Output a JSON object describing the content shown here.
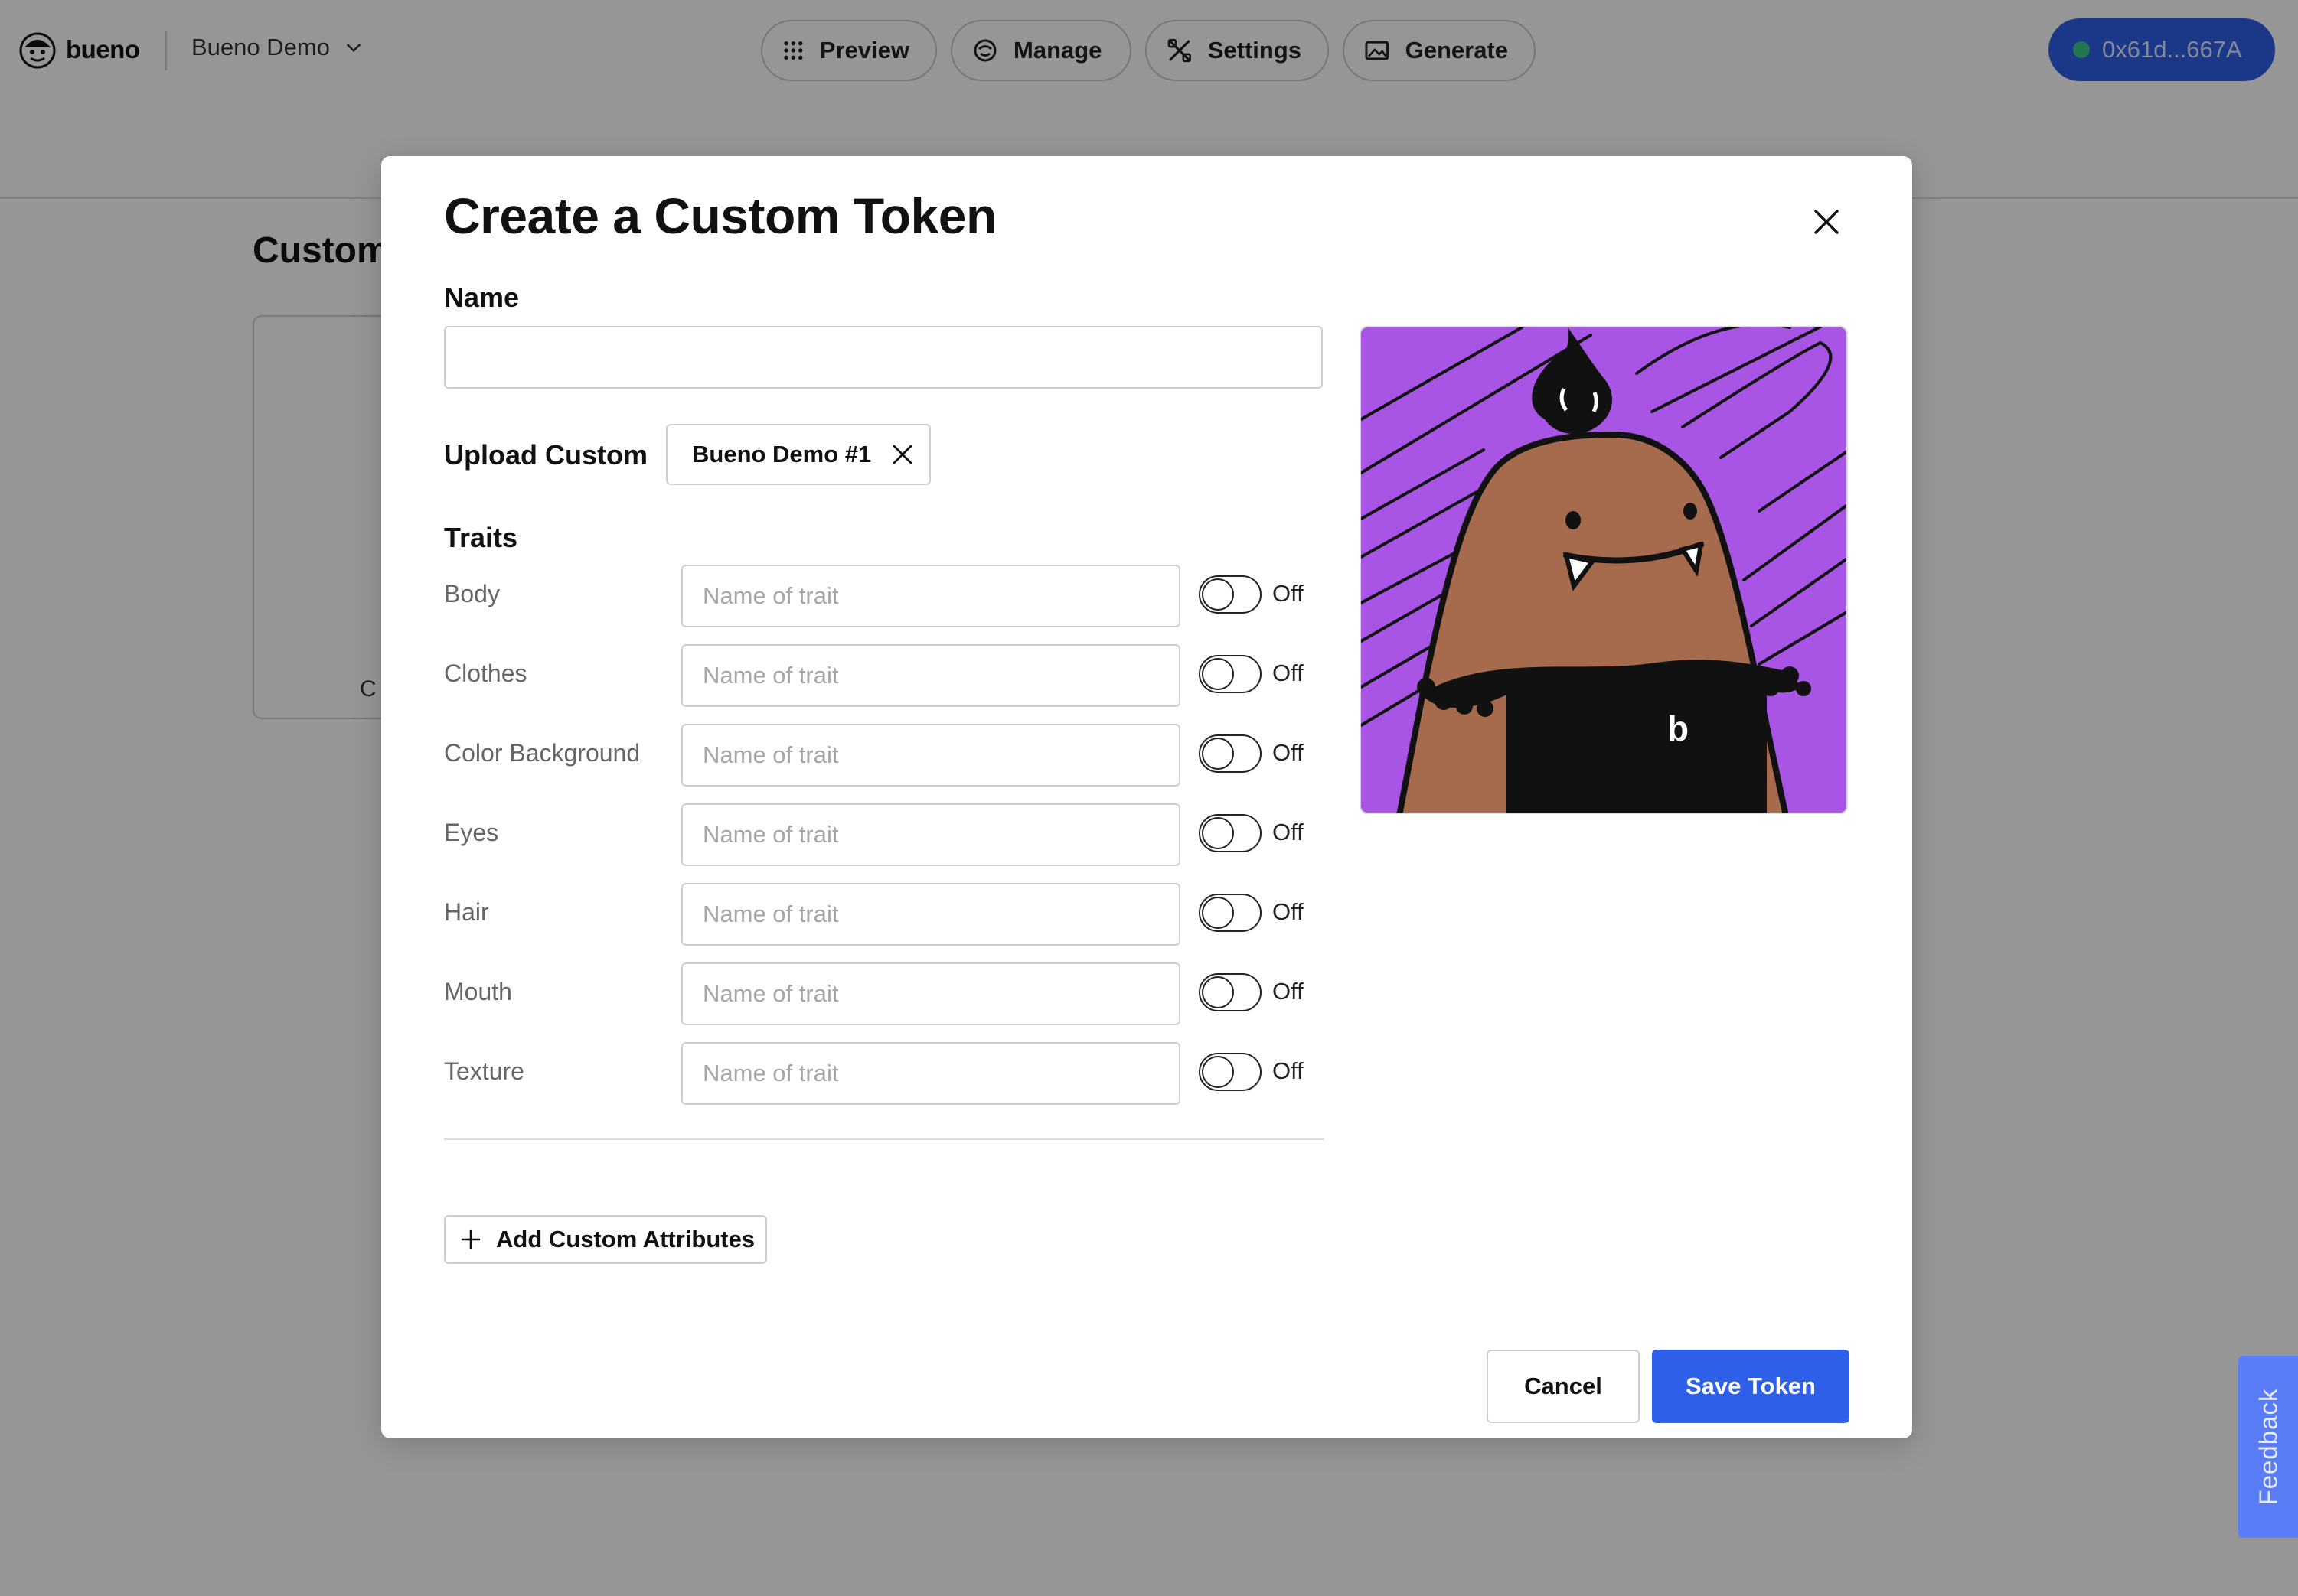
{
  "app": {
    "brand_name": "bueno",
    "project_name": "Bueno Demo",
    "nav": [
      {
        "label": "Preview",
        "icon": "grid-icon"
      },
      {
        "label": "Manage",
        "icon": "smiley-icon"
      },
      {
        "label": "Settings",
        "icon": "tools-icon"
      },
      {
        "label": "Generate",
        "icon": "image-icon"
      }
    ],
    "wallet_address": "0x61d...667A",
    "page_title_partial": "Custom",
    "card_text_partial": "C",
    "feedback_label": "Feedback"
  },
  "modal": {
    "title": "Create a Custom Token",
    "name_label": "Name",
    "name_value": "",
    "upload_label": "Upload Custom",
    "upload_file": "Bueno Demo #1",
    "traits_label": "Traits",
    "traits": [
      {
        "label": "Body",
        "placeholder": "Name of trait",
        "toggle": "Off"
      },
      {
        "label": "Clothes",
        "placeholder": "Name of trait",
        "toggle": "Off"
      },
      {
        "label": "Color Background",
        "placeholder": "Name of trait",
        "toggle": "Off"
      },
      {
        "label": "Eyes",
        "placeholder": "Name of trait",
        "toggle": "Off"
      },
      {
        "label": "Hair",
        "placeholder": "Name of trait",
        "toggle": "Off"
      },
      {
        "label": "Mouth",
        "placeholder": "Name of trait",
        "toggle": "Off"
      },
      {
        "label": "Texture",
        "placeholder": "Name of trait",
        "toggle": "Off"
      }
    ],
    "add_attributes_label": "Add Custom Attributes",
    "cancel_label": "Cancel",
    "save_label": "Save Token",
    "preview_letter": "b"
  },
  "colors": {
    "accent": "#2e5fe8",
    "wallet_status": "#39c98a",
    "preview_background": "#a855e6",
    "character_body": "#a56b4c",
    "feedback_tab": "#5a7cf6"
  }
}
